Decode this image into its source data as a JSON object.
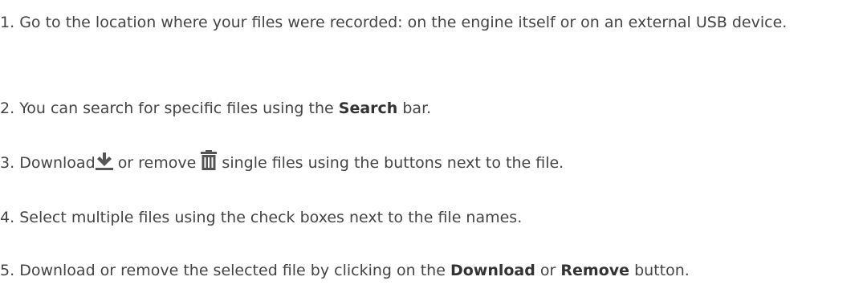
{
  "steps": [
    {
      "number": "1.",
      "text": "Go to the location where your files were recorded: on the engine itself or on an external USB device."
    },
    {
      "number": "2.",
      "pre": "You can search for specific files using the",
      "bold": "Search",
      "post": "bar."
    },
    {
      "number": "3.",
      "pre": "Download",
      "mid": "or remove",
      "post": "single files using the buttons next to the file.",
      "icons": [
        "download-icon",
        "trash-icon"
      ]
    },
    {
      "number": "4.",
      "text": "Select multiple files using the check boxes next to the file names."
    },
    {
      "number": "5.",
      "pre": "Download or remove the selected file by clicking on the",
      "bold1": "Download",
      "mid": "or",
      "bold2": "Remove",
      "post": "button."
    }
  ],
  "colors": {
    "text": "#444444",
    "icon": "#555555"
  }
}
